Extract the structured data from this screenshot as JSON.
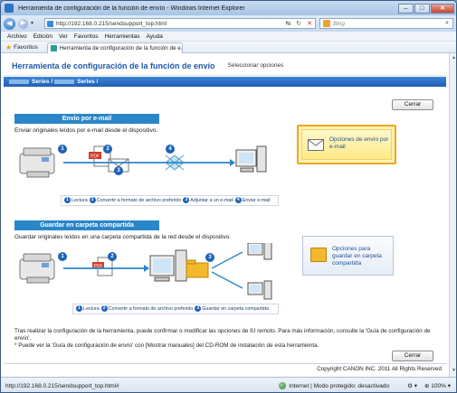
{
  "window": {
    "title": "Herramienta de configuración de la función de envío - Windows Internet Explorer",
    "controls": [
      "–",
      "□",
      "✕"
    ]
  },
  "address_bar": {
    "back_icon": "arrow-left-icon",
    "forward_icon": "arrow-right-icon",
    "url": "http://192.168.0.215/sendsupport_top.html",
    "search_placeholder": "Bing",
    "refresh_glyph": "↻",
    "stop_glyph": "✕",
    "compat_glyph": "⇆"
  },
  "menu": [
    "Archivo",
    "Edición",
    "Ver",
    "Favoritos",
    "Herramientas",
    "Ayuda"
  ],
  "favorites_bar": {
    "favorites_label": "Favoritos",
    "tab_label": "Herramienta de configuración de la función de e..."
  },
  "page": {
    "title": "Herramienta de configuración de la función de envío",
    "subtitle": "Seleccionar opciones",
    "series": "Series / ",
    "series2": "Series /",
    "cancel_label": "Cerrar"
  },
  "email_section": {
    "title": "Envío por e-mail",
    "description": "Enviar originales leídos por e-mail desde el dispositivo.",
    "badges": [
      "1",
      "2",
      "3",
      "4"
    ],
    "steps": [
      {
        "num": "1",
        "label": "Lectura"
      },
      {
        "num": "2",
        "label": "Convertir a formato de archivo preferido"
      },
      {
        "num": "3",
        "label": "Adjuntar a un e-mail"
      },
      {
        "num": "4",
        "label": "Enviar e-mail"
      }
    ],
    "option_label": "Opciones de envío por e-mail",
    "pdf_label": "PDF"
  },
  "folder_section": {
    "title": "Guardar en carpeta compartida",
    "description": "Guardar originales leídos en una carpeta compartida de la red desde el dispositivo.",
    "badges": [
      "1",
      "2",
      "3"
    ],
    "steps": [
      {
        "num": "1",
        "label": "Lectura"
      },
      {
        "num": "2",
        "label": "Convertir a formato de archivo preferido"
      },
      {
        "num": "3",
        "label": "Guardar en carpeta compartida"
      }
    ],
    "option_label": "Opciones para guardar en carpeta compartida",
    "pdf_label": "PDF"
  },
  "footer": {
    "note1": "Tras realizar la configuración de la herramienta, puede confirmar o modificar las opciones de IU remoto. Para más información, consulte la 'Guía de configuración de envío'.",
    "note2": "* Puede ver la 'Guía de configuración de envío' con [Mostrar manuales] del CD-ROM de instalación de esta herramienta.",
    "cancel_label": "Cerrar",
    "copyright": "Copyright CANON INC. 2011 All Rights Reserved"
  },
  "status_bar": {
    "url": "http://192.168.0.215/sendsupport_top.html#",
    "zone": "Internet | Modo protegido: desactivado",
    "zoom": "100%",
    "zoom_prefix": " ▾",
    "settings_glyph": "⚙ ▾"
  },
  "colors": {
    "accent": "#2a86c8",
    "title_blue": "#1f58a7",
    "highlight": "#f0a520"
  }
}
